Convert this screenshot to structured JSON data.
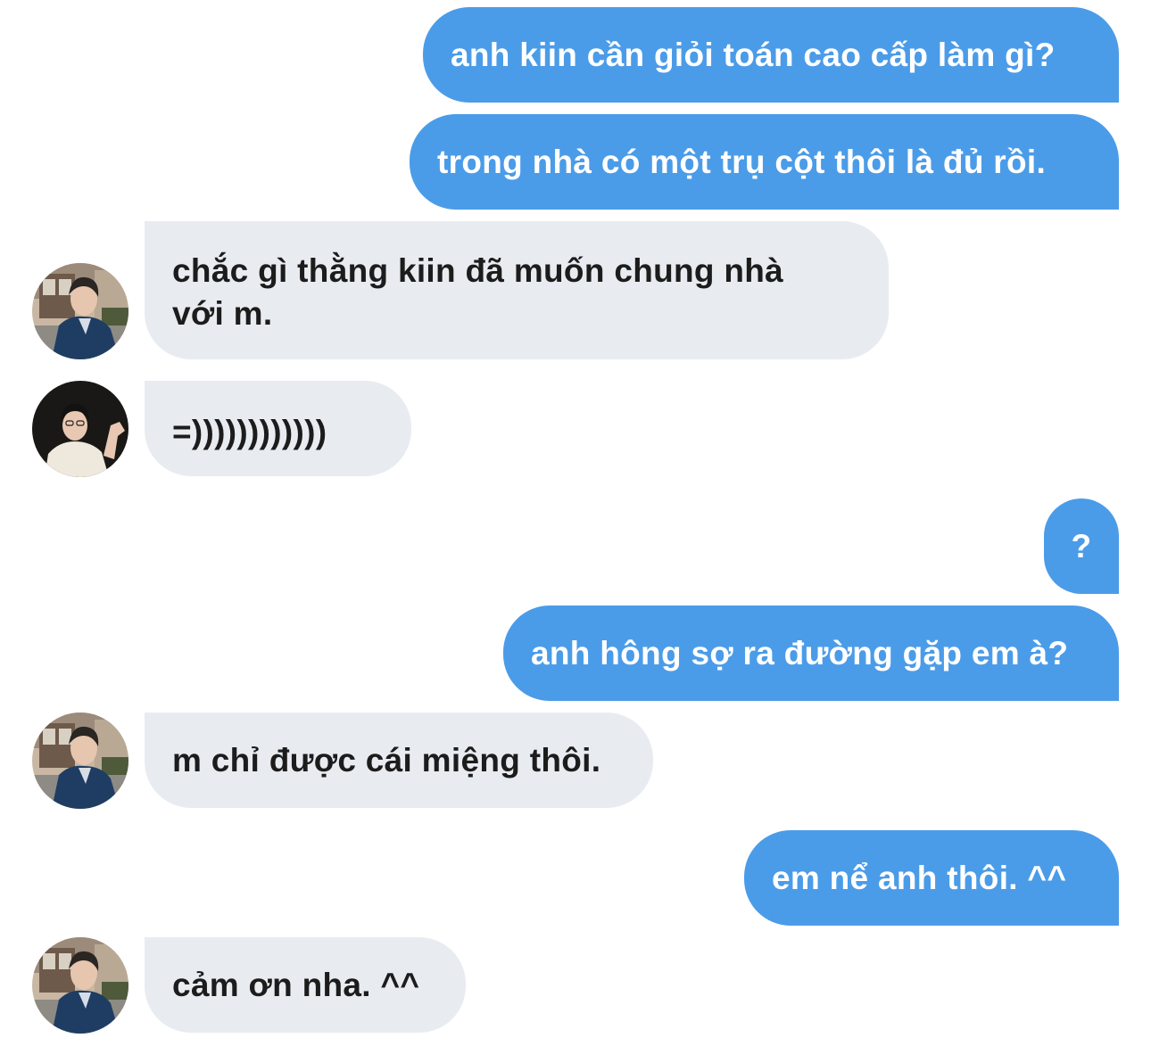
{
  "messages": [
    {
      "side": "out",
      "text": "anh kiin cần giỏi toán cao cấp làm gì?"
    },
    {
      "side": "out",
      "text": "trong nhà có một trụ cột thôi là đủ rồi."
    },
    {
      "side": "in",
      "avatar": "avatar-man-blue-jacket",
      "text_line1": "chắc gì thằng kiin đã muốn chung nhà",
      "text_line2": "với m."
    },
    {
      "side": "in",
      "avatar": "avatar-man-white-tshirt",
      "text": "=))))))))))))"
    },
    {
      "side": "out",
      "text": "?"
    },
    {
      "side": "out",
      "text": "anh hông sợ ra đường gặp em à?"
    },
    {
      "side": "in",
      "avatar": "avatar-man-blue-jacket",
      "text": "m chỉ được cái miệng thôi."
    },
    {
      "side": "out",
      "text": "em nể anh thôi. ^^"
    },
    {
      "side": "in",
      "avatar": "avatar-man-blue-jacket",
      "text": "cảm ơn nha. ^^"
    }
  ],
  "colors": {
    "outgoing_bubble": "#4b9ce8",
    "incoming_bubble": "#e8ecf0",
    "outgoing_text": "#ffffff",
    "incoming_text": "#1c1c1c"
  }
}
